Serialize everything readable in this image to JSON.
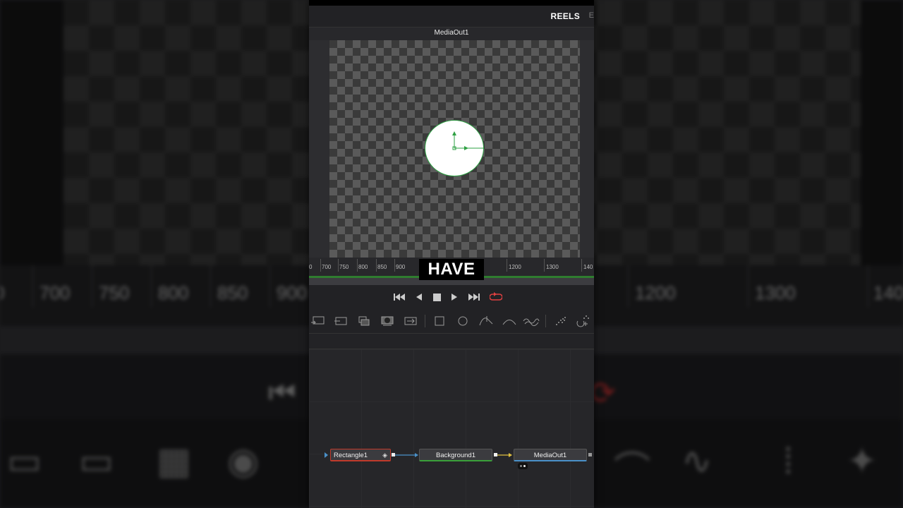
{
  "header": {
    "tab": "REELS",
    "separator": "E"
  },
  "viewer": {
    "title": "MediaOut1"
  },
  "ruler": {
    "ticks": [
      "0",
      "700",
      "750",
      "800",
      "850",
      "900",
      "1200",
      "1300",
      "140"
    ]
  },
  "caption": {
    "text": "HAVE"
  },
  "transport": {
    "buttons": [
      "skip-to-start-icon",
      "play-reverse-icon",
      "stop-icon",
      "play-icon",
      "skip-to-end-icon",
      "loop-icon"
    ],
    "loop_color": "#e04040"
  },
  "toolbar": {
    "tools": [
      "background-tool-icon",
      "merge-tool-icon",
      "transform-tool-icon",
      "mask-tool-icon",
      "loader-tool-icon",
      "rectangle-mask-icon",
      "ellipse-mask-icon",
      "polygon-mask-icon",
      "bspline-mask-icon",
      "paint-mask-icon",
      "particles-icon",
      "pemitter-icon"
    ]
  },
  "nodes": {
    "rectangle": {
      "label": "Rectangle1",
      "accent": "#c03a2b"
    },
    "background": {
      "label": "Background1",
      "accent": "#3aa03a"
    },
    "media_out": {
      "label": "MediaOut1",
      "accent": "#4a90c8"
    }
  },
  "background_copy": {
    "ruler_ticks": [
      "0",
      "700",
      "750",
      "800",
      "850",
      "900",
      "1200",
      "1300",
      "140"
    ]
  }
}
